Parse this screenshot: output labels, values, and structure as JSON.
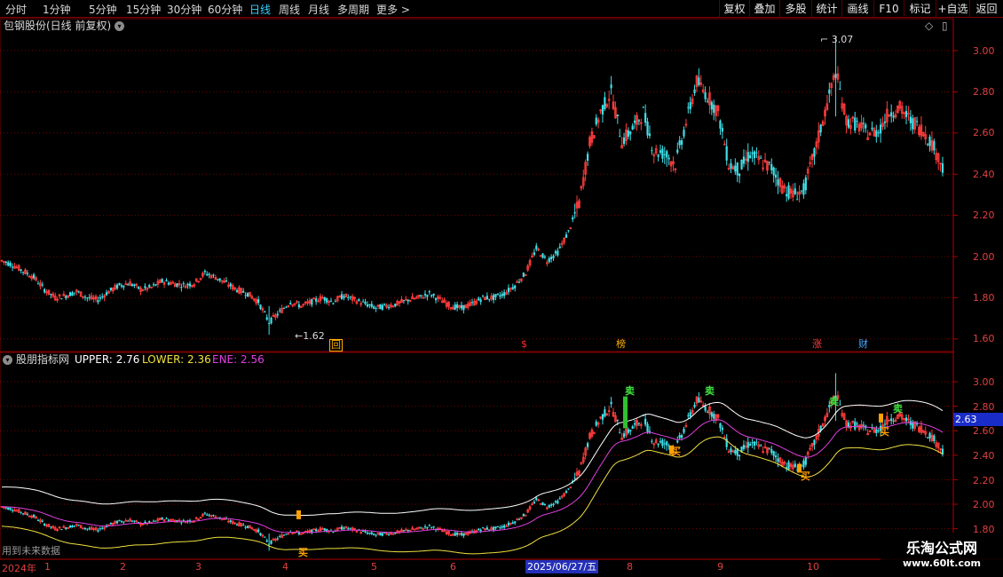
{
  "toolbar": {
    "periods": [
      "分时",
      "1分钟",
      "5分钟",
      "15分钟",
      "30分钟",
      "60分钟",
      "日线",
      "周线",
      "月线",
      "多周期",
      "更多"
    ],
    "active_period": "日线",
    "more_suffix": ">",
    "buttons": [
      "复权",
      "叠加",
      "多股",
      "统计",
      "画线",
      "F10",
      "标记",
      "+自选",
      "返回"
    ]
  },
  "main_chart": {
    "title": "包钢股份(日线 前复权)",
    "price_ticks": [
      "3.00",
      "2.80",
      "2.60",
      "2.40",
      "2.20",
      "2.00",
      "1.80",
      "1.60"
    ],
    "high_label": "3.07",
    "low_label": "1.62",
    "events": [
      {
        "text": "回",
        "color": "#ffb000",
        "boxed": true
      },
      {
        "text": "$",
        "color": "#ff3030",
        "boxed": false
      },
      {
        "text": "榜",
        "color": "#ffb000",
        "boxed": false
      },
      {
        "text": "涨",
        "color": "#ff4040",
        "boxed": false
      },
      {
        "text": "财",
        "color": "#4aa8ff",
        "boxed": false
      }
    ]
  },
  "indicator": {
    "name": "股朋指标网",
    "upper_label": "UPPER:",
    "upper_value": "2.76",
    "upper_color": "#ffffff",
    "lower_label": "LOWER:",
    "lower_value": "2.36",
    "lower_color": "#f0e040",
    "ene_label": "ENE:",
    "ene_value": "2.56",
    "ene_color": "#e040e0",
    "price_ticks": [
      "3.00",
      "2.80",
      "2.60",
      "2.40",
      "2.20",
      "2.00",
      "1.80"
    ],
    "current_value": "2.63",
    "sell_signal": "卖",
    "buy_signal": "买",
    "future_note": "用到未来数据"
  },
  "axis": {
    "year_label": "2024年",
    "months": [
      "1",
      "2",
      "3",
      "4",
      "5",
      "6",
      "7",
      "8",
      "9",
      "10"
    ],
    "cursor_date": "2025/06/27/五"
  },
  "watermark": {
    "title": "乐淘公式网",
    "url": "www.60lt.com"
  },
  "colors": {
    "up": "#ff3c3c",
    "down": "#40e0e8",
    "grid": "#7a0000",
    "axis_text": "#e04040"
  },
  "chart_data": {
    "type": "candlestick",
    "symbol": "包钢股份",
    "ylim": [
      1.56,
      3.12
    ],
    "high": 3.07,
    "low": 1.62,
    "close_path": [
      [
        0,
        1.98
      ],
      [
        5,
        1.96
      ],
      [
        10,
        1.93
      ],
      [
        15,
        1.9
      ],
      [
        20,
        1.84
      ],
      [
        25,
        1.8
      ],
      [
        30,
        1.81
      ],
      [
        35,
        1.83
      ],
      [
        40,
        1.8
      ],
      [
        45,
        1.79
      ],
      [
        50,
        1.83
      ],
      [
        55,
        1.86
      ],
      [
        60,
        1.87
      ],
      [
        65,
        1.84
      ],
      [
        70,
        1.85
      ],
      [
        75,
        1.88
      ],
      [
        80,
        1.87
      ],
      [
        85,
        1.86
      ],
      [
        90,
        1.87
      ],
      [
        95,
        1.92
      ],
      [
        100,
        1.9
      ],
      [
        105,
        1.87
      ],
      [
        110,
        1.84
      ],
      [
        115,
        1.82
      ],
      [
        120,
        1.78
      ],
      [
        125,
        1.68
      ],
      [
        130,
        1.73
      ],
      [
        135,
        1.78
      ],
      [
        140,
        1.76
      ],
      [
        145,
        1.78
      ],
      [
        150,
        1.8
      ],
      [
        155,
        1.78
      ],
      [
        160,
        1.81
      ],
      [
        165,
        1.79
      ],
      [
        170,
        1.77
      ],
      [
        175,
        1.75
      ],
      [
        180,
        1.76
      ],
      [
        185,
        1.77
      ],
      [
        190,
        1.79
      ],
      [
        195,
        1.8
      ],
      [
        200,
        1.82
      ],
      [
        205,
        1.79
      ],
      [
        210,
        1.76
      ],
      [
        215,
        1.75
      ],
      [
        220,
        1.77
      ],
      [
        225,
        1.8
      ],
      [
        230,
        1.8
      ],
      [
        235,
        1.82
      ],
      [
        240,
        1.86
      ],
      [
        245,
        1.92
      ],
      [
        250,
        2.04
      ],
      [
        255,
        1.98
      ],
      [
        260,
        2.02
      ],
      [
        265,
        2.12
      ],
      [
        270,
        2.26
      ],
      [
        275,
        2.55
      ],
      [
        280,
        2.7
      ],
      [
        285,
        2.8
      ],
      [
        290,
        2.56
      ],
      [
        295,
        2.62
      ],
      [
        300,
        2.7
      ],
      [
        305,
        2.51
      ],
      [
        310,
        2.5
      ],
      [
        315,
        2.45
      ],
      [
        320,
        2.65
      ],
      [
        325,
        2.85
      ],
      [
        330,
        2.78
      ],
      [
        335,
        2.7
      ],
      [
        340,
        2.45
      ],
      [
        345,
        2.42
      ],
      [
        350,
        2.5
      ],
      [
        355,
        2.46
      ],
      [
        360,
        2.43
      ],
      [
        365,
        2.34
      ],
      [
        370,
        2.3
      ],
      [
        375,
        2.32
      ],
      [
        380,
        2.5
      ],
      [
        385,
        2.7
      ],
      [
        390,
        2.9
      ],
      [
        395,
        2.66
      ],
      [
        400,
        2.64
      ],
      [
        405,
        2.6
      ],
      [
        410,
        2.61
      ],
      [
        415,
        2.7
      ],
      [
        420,
        2.72
      ],
      [
        425,
        2.66
      ],
      [
        430,
        2.62
      ],
      [
        435,
        2.55
      ],
      [
        440,
        2.44
      ]
    ],
    "bands": {
      "upper_last": 2.76,
      "lower_last": 2.36,
      "ene_last": 2.56
    }
  }
}
